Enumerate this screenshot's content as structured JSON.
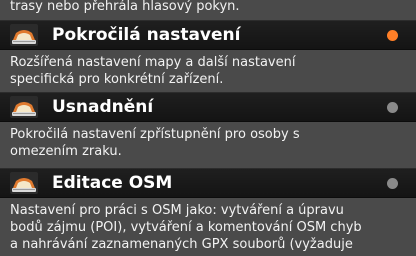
{
  "top_desc": {
    "lines": [
      "trasy nebo přehrála hlasový pokyn."
    ]
  },
  "items": [
    {
      "title": "Pokročilá nastavení",
      "icon": "car-dashboard-icon",
      "indicator_color": "#ff7f27",
      "desc_lines": [
        "Rozšířená nastavení mapy a další nastavení",
        "specifická pro konkrétní zařízení."
      ]
    },
    {
      "title": "Usnadnění",
      "icon": "car-dashboard-icon",
      "indicator_color": "#8a8a8a",
      "desc_lines": [
        "Pokročilá nastavení zpřístupnění pro osoby s",
        "omezením zraku."
      ]
    },
    {
      "title": "Editace OSM",
      "icon": "car-dashboard-icon",
      "indicator_color": "#8a8a8a",
      "desc_lines": [
        "Nastavení pro práci s OSM jako: vytváření a úpravu",
        "bodů zájmu (POI), vytváření a komentování OSM chyb",
        "a nahrávání zaznamenaných GPX souborů (vyžaduje"
      ]
    }
  ]
}
